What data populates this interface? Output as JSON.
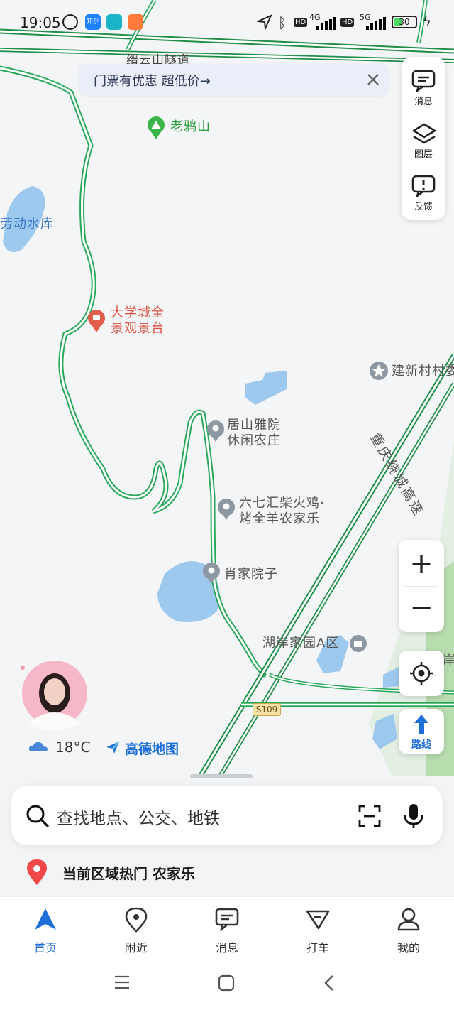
{
  "status_bar": {
    "time": "19:05",
    "app_badges": [
      "知乎"
    ],
    "network_4g": "4G",
    "network_5g": "5G",
    "hd": "HD",
    "battery": "30"
  },
  "promo": {
    "text": "门票有优惠 超低价→"
  },
  "map_toolbar": [
    {
      "label": "消息",
      "icon": "message-icon"
    },
    {
      "label": "图层",
      "icon": "layers-icon"
    },
    {
      "label": "反馈",
      "icon": "feedback-icon"
    }
  ],
  "map_labels": {
    "tunnel": "缙云山隧道",
    "reservoir": "劳动水库",
    "laoya_mountain": "老鸦山",
    "viewpoint_line1": "大学城全",
    "viewpoint_line2": "景观景台",
    "jianxin_village": "建新村村委",
    "jushan_line1": "居山雅院",
    "jushan_line2": "休闲农庄",
    "liuqi_line1": "六七汇柴火鸡·",
    "liuqi_line2": "烤全羊农家乐",
    "xiaojia": "肖家院子",
    "huan_line1": "湖岸家园A区",
    "road_s109": "S109",
    "expressway": "重庆绕城高速",
    "edge_label": "岸"
  },
  "map_controls": {
    "zoom_in": "+",
    "zoom_out": "−",
    "route_label": "路线"
  },
  "weather": {
    "temp": "18°C"
  },
  "brand": {
    "name": "高德地图"
  },
  "search": {
    "placeholder": "查找地点、公交、地铁"
  },
  "hot_area": {
    "text": "当前区域热门 农家乐"
  },
  "tabs": [
    {
      "label": "首页",
      "active": true
    },
    {
      "label": "附近",
      "active": false
    },
    {
      "label": "消息",
      "active": false
    },
    {
      "label": "打车",
      "active": false
    },
    {
      "label": "我的",
      "active": false
    }
  ],
  "colors": {
    "accent": "#1f6fd9",
    "road_green": "#2aa85a",
    "water": "#9ec9ef"
  }
}
